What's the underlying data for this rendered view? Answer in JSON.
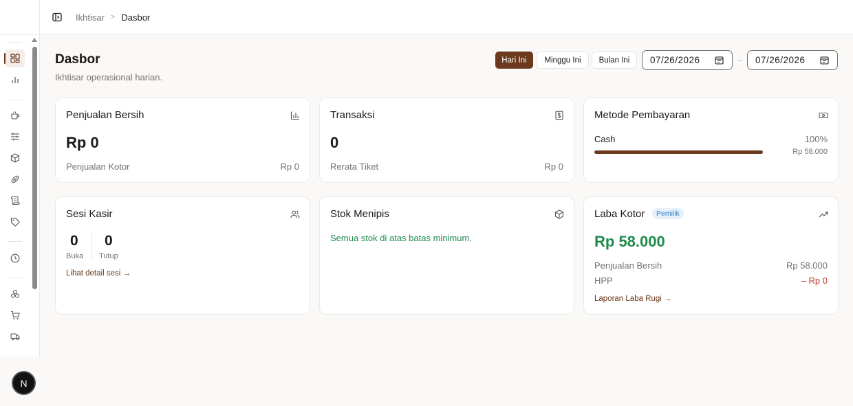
{
  "breadcrumb": {
    "parent": "Ikhtisar",
    "separator": ">",
    "current": "Dasbor"
  },
  "sidebar": {
    "items": [
      {
        "icon": "dashboard-grid-icon",
        "active": true
      },
      {
        "icon": "bar-chart-icon"
      },
      {
        "icon": "coffee-cup-icon"
      },
      {
        "icon": "sliders-icon"
      },
      {
        "icon": "package-box-icon"
      },
      {
        "icon": "ingredients-icon"
      },
      {
        "icon": "scroll-receipt-icon"
      },
      {
        "icon": "tag-icon"
      },
      {
        "icon": "clock-icon"
      },
      {
        "icon": "components-icon"
      },
      {
        "icon": "shopping-cart-icon"
      },
      {
        "icon": "truck-icon"
      }
    ],
    "avatar_initial": "N"
  },
  "header": {
    "title": "Dasbor",
    "subtitle": "Ikhtisar operasional harian.",
    "range_buttons": [
      "Hari Ini",
      "Minggu Ini",
      "Bulan Ini"
    ],
    "active_range": "Hari Ini",
    "date_from": "07/26/2026",
    "date_to": "07/26/2026",
    "date_separator": "–"
  },
  "cards": {
    "net_sales": {
      "title": "Penjualan Bersih",
      "value": "Rp 0",
      "gross_label": "Penjualan Kotor",
      "gross_value": "Rp 0"
    },
    "transactions": {
      "title": "Transaksi",
      "value": "0",
      "avg_label": "Rerata Tiket",
      "avg_value": "Rp 0"
    },
    "payment_methods": {
      "title": "Metode Pembayaran",
      "method": "Cash",
      "percent": "100%",
      "share": 1.0,
      "amount": "Rp 58.000"
    },
    "cashier_sessions": {
      "title": "Sesi Kasir",
      "open_count": "0",
      "open_label": "Buka",
      "closed_count": "0",
      "closed_label": "Tutup",
      "link": "Lihat detail sesi →"
    },
    "low_stock": {
      "title": "Stok Menipis",
      "message": "Semua stok di atas batas minimum."
    },
    "gross_profit": {
      "title": "Laba Kotor",
      "badge": "Pemilik",
      "value": "Rp 58.000",
      "net_sales_label": "Penjualan Bersih",
      "net_sales_value": "Rp 58.000",
      "cogs_label": "HPP",
      "cogs_value": "– Rp 0",
      "link": "Laporan Laba Rugi →"
    }
  },
  "colors": {
    "accent": "#6b3a1e",
    "positive": "#1f8a4c",
    "negative": "#c0392b",
    "badge_bg": "#e6f1fb",
    "badge_text": "#2f7fbf"
  }
}
